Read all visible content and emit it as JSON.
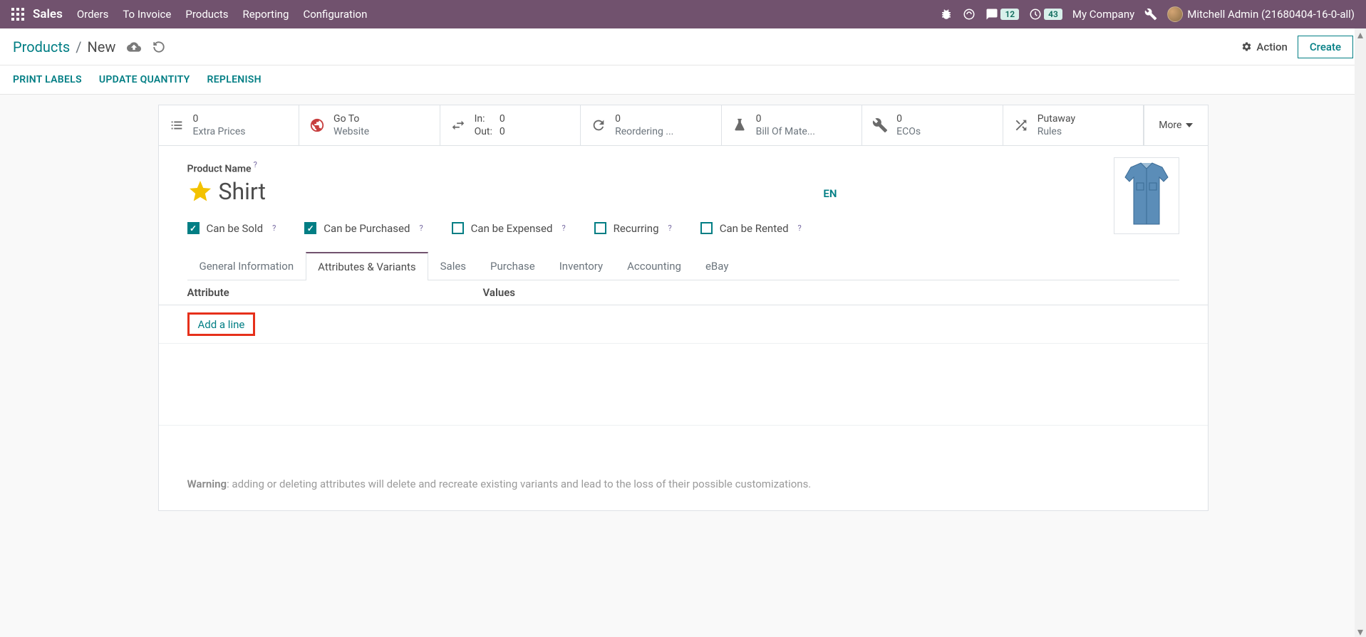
{
  "topbar": {
    "brand": "Sales",
    "menu": [
      "Orders",
      "To Invoice",
      "Products",
      "Reporting",
      "Configuration"
    ],
    "messages_badge": "12",
    "activities_badge": "43",
    "company": "My Company",
    "user": "Mitchell Admin (21680404-16-0-all)"
  },
  "breadcrumb": {
    "root": "Products",
    "current": "New",
    "action_label": "Action",
    "create_label": "Create"
  },
  "action_bar": {
    "print_labels": "PRINT LABELS",
    "update_quantity": "UPDATE QUANTITY",
    "replenish": "REPLENISH"
  },
  "stat_buttons": {
    "extra_prices": {
      "value": "0",
      "label": "Extra Prices"
    },
    "website": {
      "line1": "Go To",
      "line2": "Website"
    },
    "in_out": {
      "in_label": "In:",
      "in_value": "0",
      "out_label": "Out:",
      "out_value": "0"
    },
    "reordering": {
      "value": "0",
      "label": "Reordering ..."
    },
    "bom": {
      "value": "0",
      "label": "Bill Of Mate..."
    },
    "ecos": {
      "value": "0",
      "label": "ECOs"
    },
    "putaway": {
      "line1": "Putaway",
      "line2": "Rules"
    },
    "more": "More"
  },
  "form": {
    "name_label": "Product Name",
    "name_value": "Shirt",
    "lang": "EN",
    "checks": {
      "sold": {
        "label": "Can be Sold",
        "checked": true
      },
      "purchased": {
        "label": "Can be Purchased",
        "checked": true
      },
      "expensed": {
        "label": "Can be Expensed",
        "checked": false
      },
      "recurring": {
        "label": "Recurring",
        "checked": false
      },
      "rented": {
        "label": "Can be Rented",
        "checked": false
      }
    }
  },
  "tabs": [
    "General Information",
    "Attributes & Variants",
    "Sales",
    "Purchase",
    "Inventory",
    "Accounting",
    "eBay"
  ],
  "active_tab": "Attributes & Variants",
  "attr_table": {
    "col_attribute": "Attribute",
    "col_values": "Values",
    "add_line": "Add a line"
  },
  "warning": {
    "bold": "Warning",
    "text": ": adding or deleting attributes will delete and recreate existing variants and lead to the loss of their possible customizations."
  }
}
